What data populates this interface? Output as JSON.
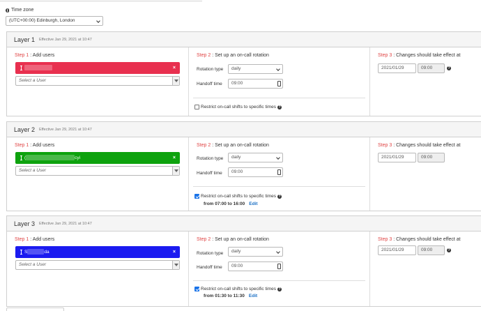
{
  "timezone": {
    "label": "Time zone",
    "value": "(UTC+00:00) Edinburgh, London"
  },
  "step1_label": "Add users",
  "step2_label": "Set up an on-call rotation",
  "step3_label": "Changes should take effect at",
  "step_prefix": {
    "s1": "Step 1",
    "s2": "Step 2",
    "s3": "Step 3",
    "sep": " : "
  },
  "rotation_type_label": "Rotation type",
  "handoff_time_label": "Handoff time",
  "restrict_label": "Restrict on-call shifts to specific times",
  "select_user_placeholder": "Select a User",
  "edit_label": "Edit",
  "colors": {
    "red_user": "#e8304f",
    "green_user": "#0ea20e",
    "blue_user": "#1b1bf0",
    "step_red": "#e04545",
    "link_blue": "#1a6fc4"
  },
  "layers": [
    {
      "title": "Layer 1",
      "effective": "Effective Jan 29, 2021 at 10:47",
      "user_suffix": "",
      "rotation_type": "daily",
      "handoff_time": "09:00",
      "restrict_checked": false,
      "from_text": "",
      "date": "2021/01/29",
      "time": "09:00"
    },
    {
      "title": "Layer 2",
      "effective": "Effective Jan 29, 2021 at 10:47",
      "user_prefix": "(",
      "user_suffix": "cyi",
      "rotation_type": "daily",
      "handoff_time": "09:00",
      "restrict_checked": true,
      "from_text": "from 07:00 to 16:00",
      "date": "2021/01/29",
      "time": "09:00"
    },
    {
      "title": "Layer 3",
      "effective": "Effective Jan 29, 2021 at 10:47",
      "user_prefix": "S",
      "user_suffix": "da",
      "rotation_type": "daily",
      "handoff_time": "09:00",
      "restrict_checked": true,
      "from_text": "from 01:30 to 11:30",
      "date": "2021/01/29",
      "time": "09:00"
    }
  ]
}
